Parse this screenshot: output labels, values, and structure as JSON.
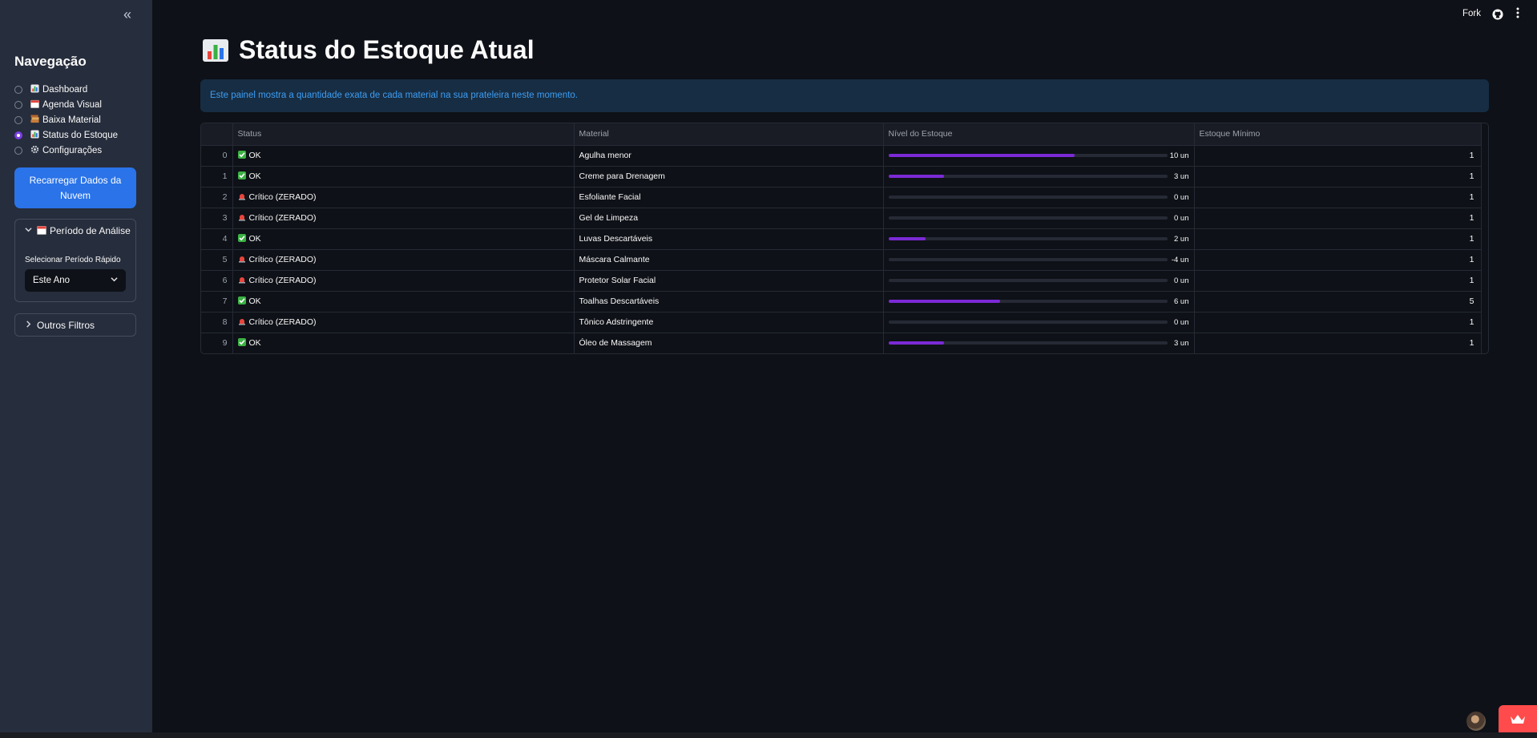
{
  "sidebar": {
    "collapse_symbol": "«",
    "nav_title": "Navegação",
    "nav_items": [
      {
        "icon": "bar-chart-icon",
        "label": "Dashboard",
        "selected": false
      },
      {
        "icon": "calendar-icon",
        "label": "Agenda Visual",
        "selected": false
      },
      {
        "icon": "books-icon",
        "label": "Baixa Material",
        "selected": false
      },
      {
        "icon": "bar-chart-icon",
        "label": "Status do Estoque",
        "selected": true
      },
      {
        "icon": "gear-icon",
        "label": "Configurações",
        "selected": false
      }
    ],
    "reload_button_line1": "Recarregar Dados da",
    "reload_button_line2": "Nuvem",
    "period_expander": {
      "title": "Período de Análise",
      "select_label": "Selecionar Período Rápido",
      "select_value": "Este Ano"
    },
    "filters_expander": {
      "title": "Outros Filtros"
    }
  },
  "topbar": {
    "fork_label": "Fork"
  },
  "main": {
    "title": "Status do Estoque Atual",
    "info_text": "Este painel mostra a quantidade exata de cada material na sua prateleira neste momento.",
    "table": {
      "headers": [
        "",
        "Status",
        "Material",
        "Nível do Estoque",
        "Estoque Mínimo"
      ],
      "rows": [
        {
          "idx": "0",
          "status": "OK",
          "status_type": "ok",
          "material": "Agulha menor",
          "level": 0.667,
          "level_label": "10 un",
          "min": "1"
        },
        {
          "idx": "1",
          "status": "OK",
          "status_type": "ok",
          "material": "Creme para Drenagem",
          "level": 0.2,
          "level_label": "3 un",
          "min": "1"
        },
        {
          "idx": "2",
          "status": "Crítico (ZERADO)",
          "status_type": "critical",
          "material": "Esfoliante Facial",
          "level": 0,
          "level_label": "0 un",
          "min": "1"
        },
        {
          "idx": "3",
          "status": "Crítico (ZERADO)",
          "status_type": "critical",
          "material": "Gel de Limpeza",
          "level": 0,
          "level_label": "0 un",
          "min": "1"
        },
        {
          "idx": "4",
          "status": "OK",
          "status_type": "ok",
          "material": "Luvas Descartáveis",
          "level": 0.133,
          "level_label": "2 un",
          "min": "1"
        },
        {
          "idx": "5",
          "status": "Crítico (ZERADO)",
          "status_type": "critical",
          "material": "Máscara Calmante",
          "level": 0,
          "level_label": "-4 un",
          "min": "1"
        },
        {
          "idx": "6",
          "status": "Crítico (ZERADO)",
          "status_type": "critical",
          "material": "Protetor Solar Facial",
          "level": 0,
          "level_label": "0 un",
          "min": "1"
        },
        {
          "idx": "7",
          "status": "OK",
          "status_type": "ok",
          "material": "Toalhas Descartáveis",
          "level": 0.4,
          "level_label": "6 un",
          "min": "5"
        },
        {
          "idx": "8",
          "status": "Crítico (ZERADO)",
          "status_type": "critical",
          "material": "Tônico Adstringente",
          "level": 0,
          "level_label": "0 un",
          "min": "1"
        },
        {
          "idx": "9",
          "status": "OK",
          "status_type": "ok",
          "material": "Óleo de Massagem",
          "level": 0.2,
          "level_label": "3 un",
          "min": "1"
        }
      ]
    }
  },
  "colors": {
    "accent": "#7b2ad6",
    "primary_button": "#2a73e8",
    "info_bg": "#172d43",
    "info_text": "#3d9df3",
    "critical": "#e8453c",
    "ok": "#3bb143"
  }
}
